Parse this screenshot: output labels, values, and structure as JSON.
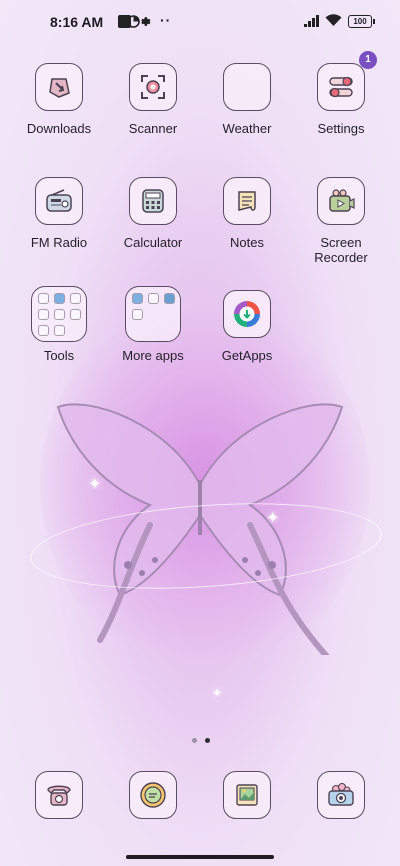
{
  "status_bar": {
    "time": "8:16 AM",
    "battery": "100"
  },
  "apps": [
    {
      "id": "downloads",
      "label": "Downloads",
      "icon": "downloads-icon"
    },
    {
      "id": "scanner",
      "label": "Scanner",
      "icon": "scanner-icon"
    },
    {
      "id": "weather",
      "label": "Weather",
      "icon": "weather-icon"
    },
    {
      "id": "settings",
      "label": "Settings",
      "icon": "settings-icon",
      "badge": "1"
    },
    {
      "id": "fm-radio",
      "label": "FM Radio",
      "icon": "radio-icon"
    },
    {
      "id": "calculator",
      "label": "Calculator",
      "icon": "calculator-icon"
    },
    {
      "id": "notes",
      "label": "Notes",
      "icon": "notes-icon"
    },
    {
      "id": "screen-recorder",
      "label": "Screen\nRecorder",
      "icon": "screen-recorder-icon"
    },
    {
      "id": "tools",
      "label": "Tools",
      "icon": "folder-icon"
    },
    {
      "id": "more-apps",
      "label": "More apps",
      "icon": "folder-icon"
    },
    {
      "id": "getapps",
      "label": "GetApps",
      "icon": "getapps-icon"
    }
  ],
  "page_indicator": {
    "pages": 2,
    "current": 2
  },
  "dock": [
    {
      "id": "phone",
      "icon": "phone-icon"
    },
    {
      "id": "messages",
      "icon": "messages-icon"
    },
    {
      "id": "gallery",
      "icon": "gallery-icon"
    },
    {
      "id": "camera",
      "icon": "camera-icon"
    }
  ],
  "colors": {
    "accent": "#7a4fc0",
    "icon_outline": "#5a4d63"
  }
}
